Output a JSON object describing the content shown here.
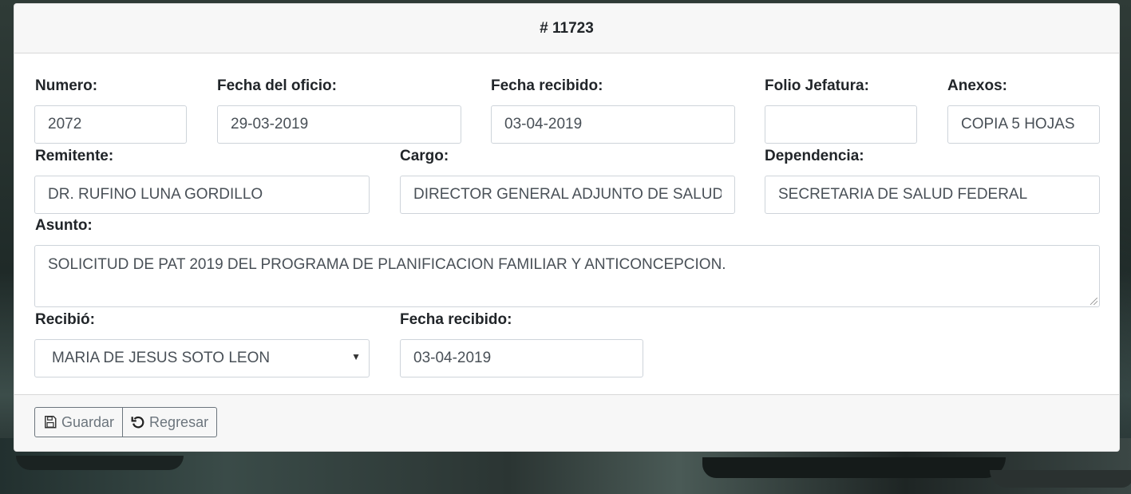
{
  "header": {
    "title": "# 11723"
  },
  "form": {
    "numero": {
      "label": "Numero:",
      "value": "2072"
    },
    "fecha_oficio": {
      "label": "Fecha del oficio:",
      "value": "29-03-2019"
    },
    "fecha_recibido": {
      "label": "Fecha recibido:",
      "value": "03-04-2019"
    },
    "folio_jefatura": {
      "label": "Folio Jefatura:",
      "value": ""
    },
    "anexos": {
      "label": "Anexos:",
      "value": "COPIA 5 HOJAS"
    },
    "remitente": {
      "label": "Remitente:",
      "value": "DR. RUFINO LUNA GORDILLO"
    },
    "cargo": {
      "label": "Cargo:",
      "value": "DIRECTOR GENERAL ADJUNTO DE SALUD REPRODUCTIVA"
    },
    "dependencia": {
      "label": "Dependencia:",
      "value": "SECRETARIA DE SALUD FEDERAL"
    },
    "asunto": {
      "label": "Asunto:",
      "value": "SOLICITUD DE PAT 2019 DEL PROGRAMA DE PLANIFICACION FAMILIAR Y ANTICONCEPCION."
    },
    "recibio": {
      "label": "Recibió:",
      "value": "MARIA DE JESUS SOTO LEON"
    },
    "fecha_recibido2": {
      "label": "Fecha recibido:",
      "value": "03-04-2019"
    }
  },
  "footer": {
    "save_label": "Guardar",
    "back_label": "Regresar",
    "save_icon": "floppy-disk-icon",
    "back_icon": "undo-icon"
  }
}
